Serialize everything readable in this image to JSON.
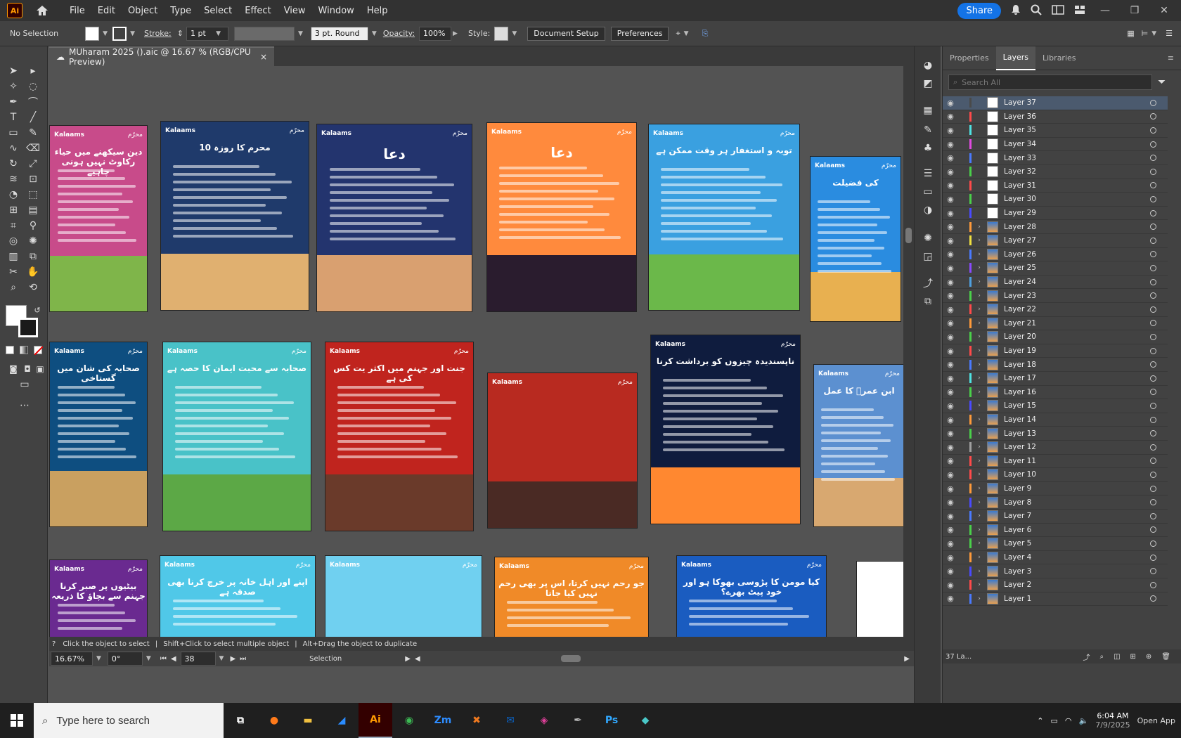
{
  "menubar": {
    "app_logo": "Ai",
    "items": [
      "File",
      "Edit",
      "Object",
      "Type",
      "Select",
      "Effect",
      "View",
      "Window",
      "Help"
    ],
    "share_label": "Share"
  },
  "control_bar": {
    "selection": "No Selection",
    "stroke_label": "Stroke:",
    "stroke_value": "1 pt",
    "brush_label": "3 pt. Round",
    "opacity_label": "Opacity:",
    "opacity_value": "100%",
    "style_label": "Style:",
    "document_setup": "Document Setup",
    "preferences": "Preferences"
  },
  "document_tab": {
    "title": "MUharam 2025 ().aic @ 16.67 % (RGB/CPU Preview)",
    "close": "×"
  },
  "artboards": [
    {
      "brand": "Kalaams",
      "badge": "محرّم",
      "title": "دین سیکھنے میں حیاء رکاوٹ نہیں ہونی چاہیے",
      "bg": "#c84b8a",
      "ground": "#7fb54a"
    },
    {
      "brand": "Kalaams",
      "badge": "محرّم",
      "title": "10 محرم کا روزہ",
      "bg": "#1f3a6b",
      "ground": "#e0b070"
    },
    {
      "brand": "Kalaams",
      "badge": "محرّم",
      "title": "دعا",
      "bg": "#23346e",
      "ground": "#d9a070"
    },
    {
      "brand": "Kalaams",
      "badge": "محرّم",
      "title": "دعا",
      "bg": "#ff8a3d",
      "ground": "#2a1c2e"
    },
    {
      "brand": "Kalaams",
      "badge": "محرّم",
      "title": "توبہ و استغفار ہر وقت ممکن ہے",
      "bg": "#3aa0e0",
      "ground": "#6bb84a"
    },
    {
      "brand": "Kalaams",
      "badge": "محرّم",
      "title": "کی فضیلت",
      "bg": "#2a8ce0",
      "ground": "#e8b050"
    },
    {
      "brand": "Kalaams",
      "badge": "محرّم",
      "title": "صحابہ کی شان میں گستاخی",
      "bg": "#0e4e80",
      "ground": "#c9a060"
    },
    {
      "brand": "Kalaams",
      "badge": "محرّم",
      "title": "صحابہ سے محبت ایمان کا حصہ ہے",
      "bg": "#49c2c8",
      "ground": "#5ca846"
    },
    {
      "brand": "Kalaams",
      "badge": "محرّم",
      "title": "جنت اور جہنم میں اکثر یت کس کی ہے",
      "bg": "#c0241e",
      "ground": "#6a3a2a"
    },
    {
      "brand": "Kalaams",
      "badge": "محرّم",
      "title": "",
      "bg": "#b82a20",
      "ground": "#4a2a24"
    },
    {
      "brand": "Kalaams",
      "badge": "محرّم",
      "title": "ناپسندیدہ چیزوں کو برداشت کرنا",
      "bg": "#0f1c3e",
      "ground": "#ff8830"
    },
    {
      "brand": "Kalaams",
      "badge": "محرّم",
      "title": "ابن عمرؓ کا عمل",
      "bg": "#5c90d0",
      "ground": "#d8a870"
    },
    {
      "brand": "Kalaams",
      "badge": "محرّم",
      "title": "بیٹیوں پر صبر کرنا جہنم سے بچاؤ کا ذریعہ",
      "bg": "#6a2a90",
      "ground": "#6a2a90"
    },
    {
      "brand": "Kalaams",
      "badge": "محرّم",
      "title": "اپنے اور اہل خانہ پر خرچ کرنا بھی صدقہ ہے",
      "bg": "#50c8e8",
      "ground": "#50c8e8"
    },
    {
      "brand": "Kalaams",
      "badge": "محرّم",
      "title": "",
      "bg": "#70d0f0",
      "ground": "#70d0f0"
    },
    {
      "brand": "Kalaams",
      "badge": "محرّم",
      "title": "جو رحم نہیں کرتا، اس پر بھی رحم نہیں کیا جاتا",
      "bg": "#f08a28",
      "ground": "#f08a28"
    },
    {
      "brand": "Kalaams",
      "badge": "محرّم",
      "title": "کیا مومن کا پڑوسی بھوکا ہو اور خود پیٹ بھرے؟",
      "bg": "#1a5cc0",
      "ground": "#1a5cc0"
    },
    {
      "brand": "",
      "badge": "",
      "title": "",
      "bg": "#ffffff",
      "ground": "#ffffff"
    }
  ],
  "panel": {
    "tabs": [
      "Properties",
      "Layers",
      "Libraries"
    ],
    "search_placeholder": "Search All",
    "layers": [
      {
        "name": "Layer 37",
        "color": "#4a4a4a",
        "sel": true,
        "expand": false
      },
      {
        "name": "Layer 36",
        "color": "#ff4a4a",
        "expand": false
      },
      {
        "name": "Layer 35",
        "color": "#4fe3e3",
        "expand": false
      },
      {
        "name": "Layer 34",
        "color": "#e04ae0",
        "expand": false
      },
      {
        "name": "Layer 33",
        "color": "#4a7aff",
        "expand": false
      },
      {
        "name": "Layer 32",
        "color": "#4ad04a",
        "expand": false
      },
      {
        "name": "Layer 31",
        "color": "#ff4a4a",
        "expand": false
      },
      {
        "name": "Layer 30",
        "color": "#4ad04a",
        "expand": false
      },
      {
        "name": "Layer 29",
        "color": "#4a4aff",
        "expand": false
      },
      {
        "name": "Layer 28",
        "color": "#ff9a3a",
        "expand": true
      },
      {
        "name": "Layer 27",
        "color": "#f0e040",
        "expand": true
      },
      {
        "name": "Layer 26",
        "color": "#4a7aff",
        "expand": true
      },
      {
        "name": "Layer 25",
        "color": "#8a4aff",
        "expand": true
      },
      {
        "name": "Layer 24",
        "color": "#4fa0e0",
        "expand": true
      },
      {
        "name": "Layer 23",
        "color": "#4ad04a",
        "expand": true
      },
      {
        "name": "Layer 22",
        "color": "#ff4a4a",
        "expand": true
      },
      {
        "name": "Layer 21",
        "color": "#ff9a3a",
        "expand": true
      },
      {
        "name": "Layer 20",
        "color": "#4ad04a",
        "expand": true
      },
      {
        "name": "Layer 19",
        "color": "#ff4a4a",
        "expand": true
      },
      {
        "name": "Layer 18",
        "color": "#4a7aff",
        "expand": true
      },
      {
        "name": "Layer 17",
        "color": "#4fe3e3",
        "expand": true
      },
      {
        "name": "Layer 16",
        "color": "#4ad04a",
        "expand": true
      },
      {
        "name": "Layer 15",
        "color": "#4a4aff",
        "expand": true
      },
      {
        "name": "Layer 14",
        "color": "#ff9a3a",
        "expand": true
      },
      {
        "name": "Layer 13",
        "color": "#4ad04a",
        "expand": true
      },
      {
        "name": "Layer 12",
        "color": "#a0a0a0",
        "expand": true
      },
      {
        "name": "Layer 11",
        "color": "#ff4a4a",
        "expand": true
      },
      {
        "name": "Layer 10",
        "color": "#ff4a4a",
        "expand": true
      },
      {
        "name": "Layer 9",
        "color": "#ff9a3a",
        "expand": true
      },
      {
        "name": "Layer 8",
        "color": "#4a4aff",
        "expand": true
      },
      {
        "name": "Layer 7",
        "color": "#4a7aff",
        "expand": true
      },
      {
        "name": "Layer 6",
        "color": "#4ad04a",
        "expand": true
      },
      {
        "name": "Layer 5",
        "color": "#4ad04a",
        "expand": true
      },
      {
        "name": "Layer 4",
        "color": "#ff9a3a",
        "expand": true
      },
      {
        "name": "Layer 3",
        "color": "#4a4aff",
        "expand": true
      },
      {
        "name": "Layer 2",
        "color": "#ff4a4a",
        "expand": true
      },
      {
        "name": "Layer 1",
        "color": "#4a7aff",
        "expand": true
      }
    ],
    "footer_count": "37 La..."
  },
  "status": {
    "hint1": "Click the object to select",
    "hint2": "Shift+Click to select multiple object",
    "hint3": "Alt+Drag the object to duplicate",
    "zoom": "16.67%",
    "rotation": "0°",
    "artboard_num": "38",
    "mode": "Selection"
  },
  "taskbar": {
    "search_placeholder": "Type here to search",
    "time": "6:04 AM",
    "date": "7/9/2025",
    "open_app": "Open App",
    "apps": [
      "Ai",
      "Zm",
      "Ps"
    ]
  }
}
